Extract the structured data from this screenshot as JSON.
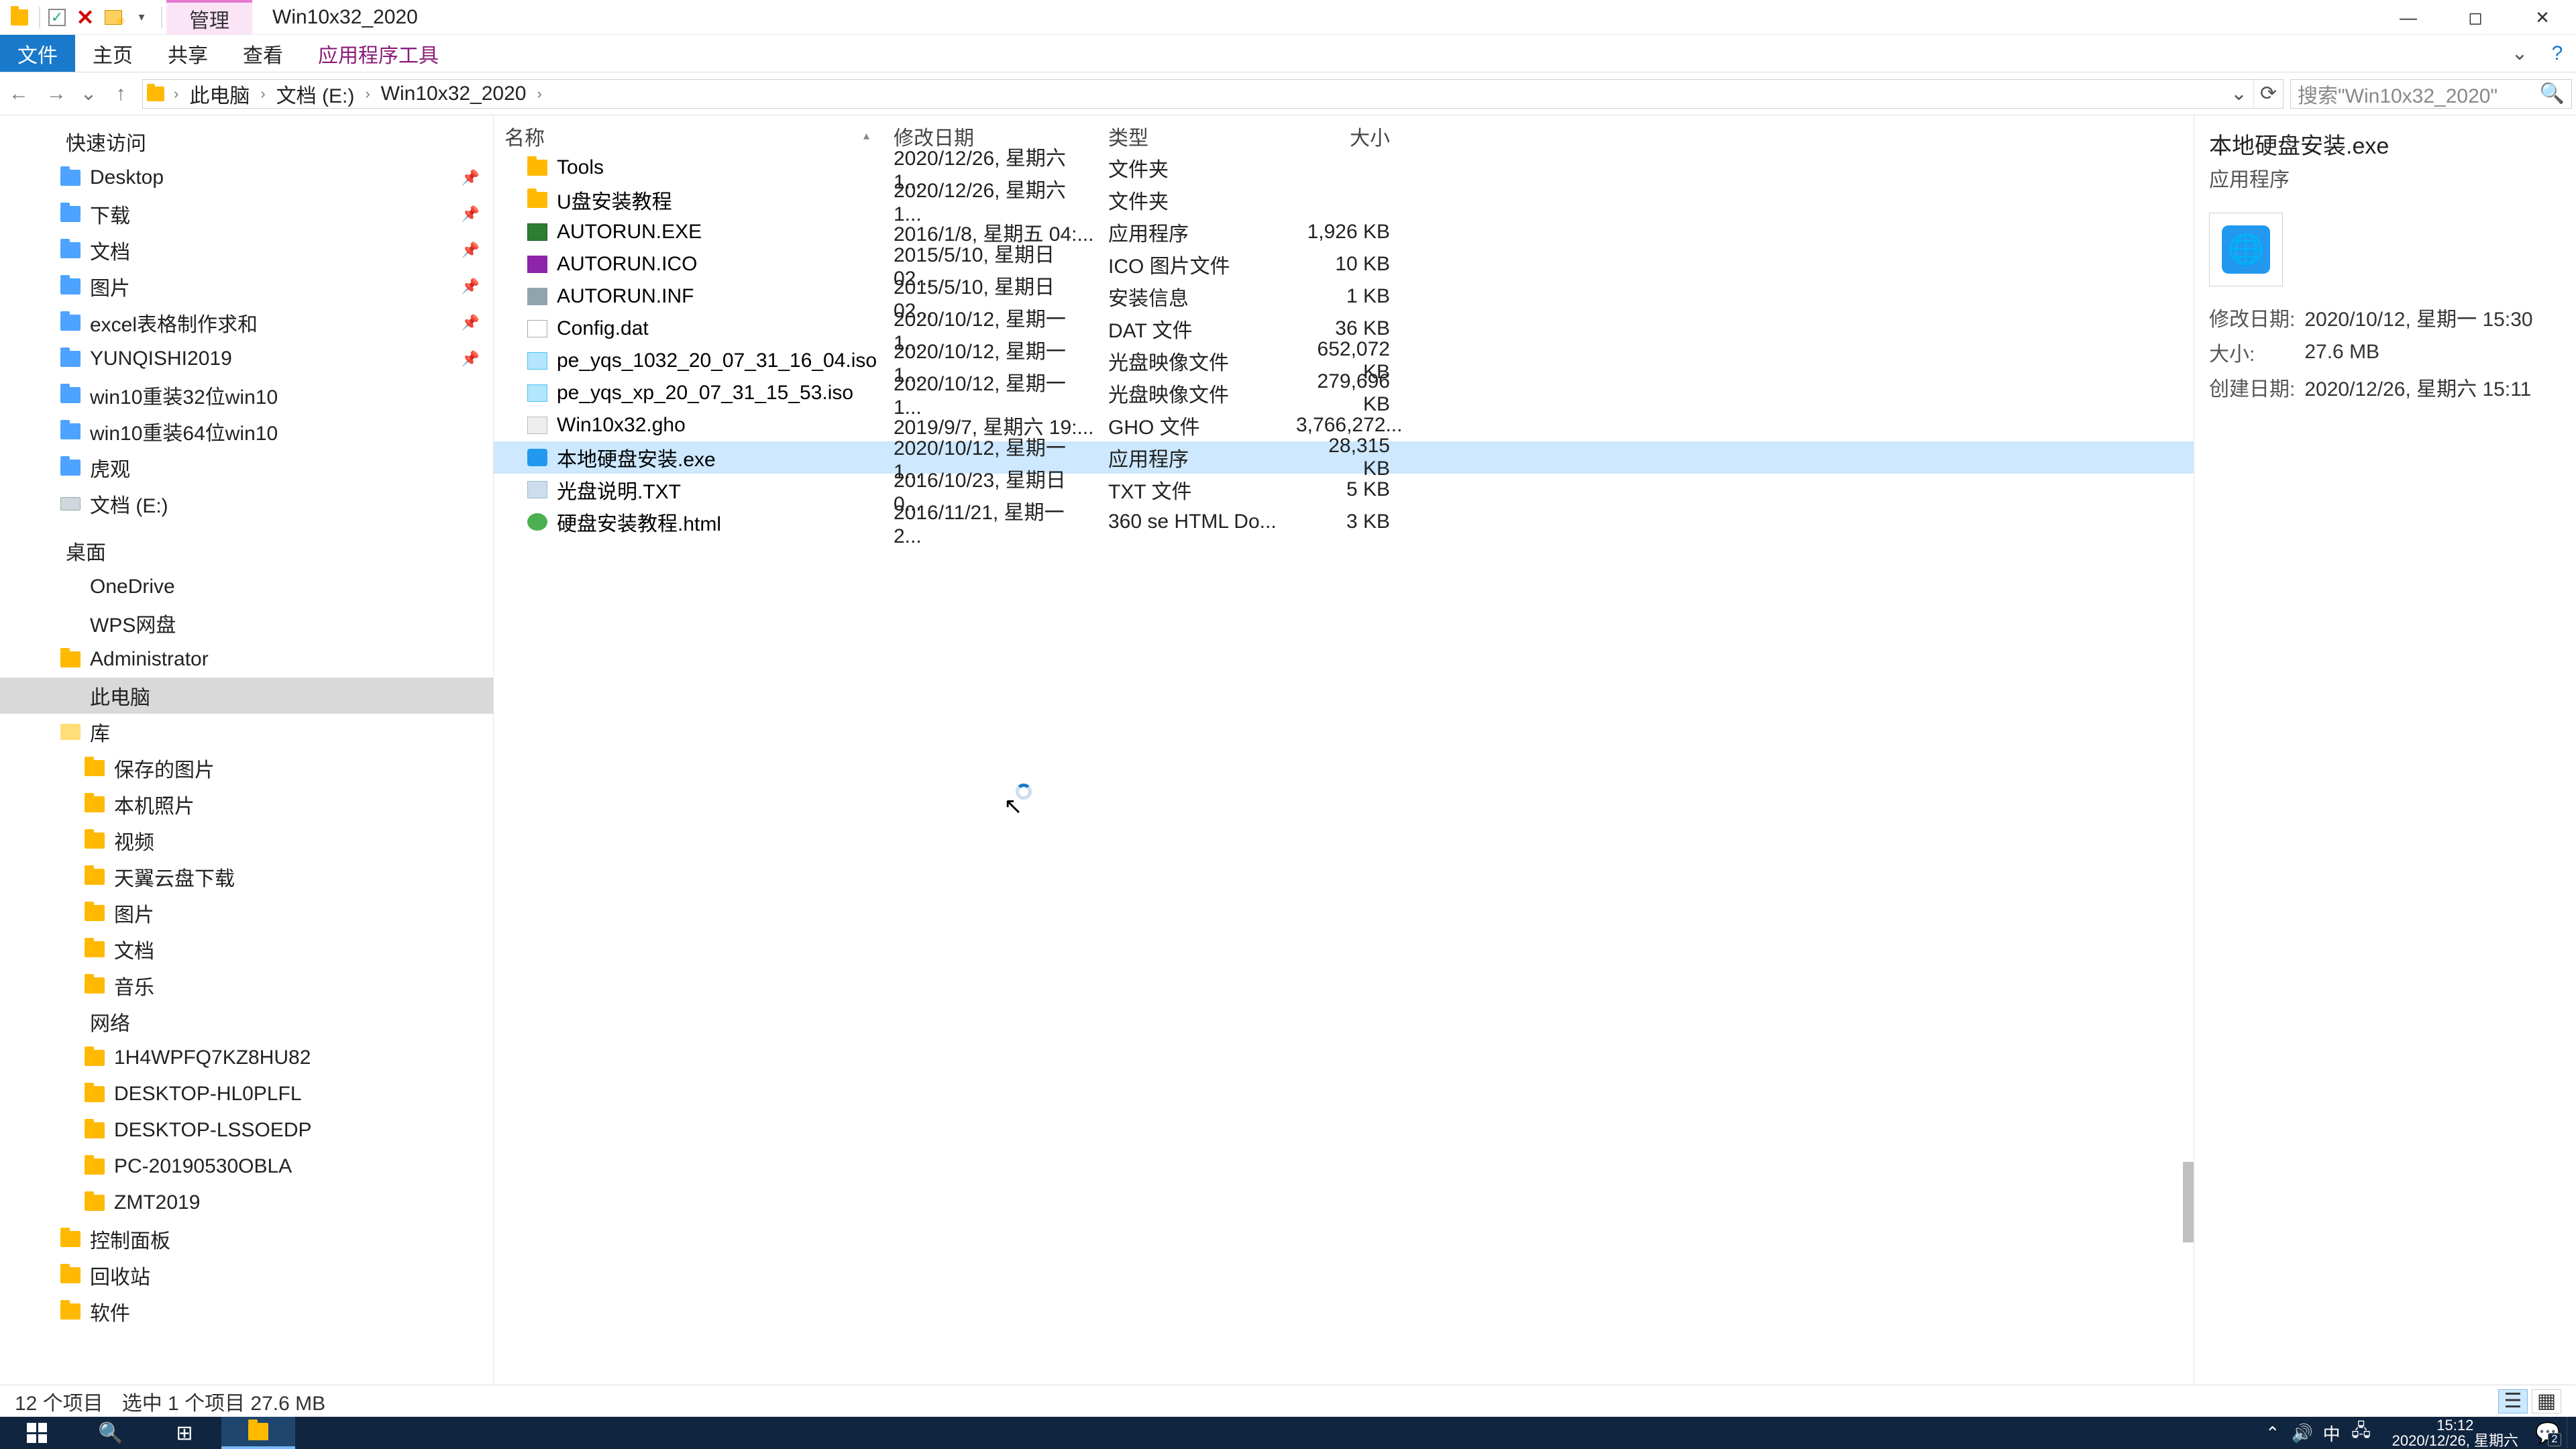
{
  "title": {
    "manage": "管理",
    "folder": "Win10x32_2020"
  },
  "ribbon": {
    "file": "文件",
    "home": "主页",
    "share": "共享",
    "view": "查看",
    "apptools": "应用程序工具"
  },
  "nav": {
    "segs": [
      "此电脑",
      "文档 (E:)",
      "Win10x32_2020"
    ]
  },
  "search": {
    "placeholder": "搜索\"Win10x32_2020\""
  },
  "tree": {
    "quick": "快速访问",
    "quick_items": [
      {
        "t": "Desktop",
        "pin": true
      },
      {
        "t": "下载",
        "pin": true
      },
      {
        "t": "文档",
        "pin": true
      },
      {
        "t": "图片",
        "pin": true
      },
      {
        "t": "excel表格制作求和",
        "pin": true
      },
      {
        "t": "YUNQISHI2019",
        "pin": true
      },
      {
        "t": "win10重装32位win10",
        "pin": false
      },
      {
        "t": "win10重装64位win10",
        "pin": false
      },
      {
        "t": "虎观",
        "pin": false
      },
      {
        "t": "文档 (E:)",
        "pin": false
      }
    ],
    "desktop": "桌面",
    "desktop_items": [
      {
        "t": "OneDrive"
      },
      {
        "t": "WPS网盘"
      },
      {
        "t": "Administrator"
      },
      {
        "t": "此电脑",
        "sel": true
      },
      {
        "t": "库"
      },
      {
        "t": "保存的图片",
        "lvl": 3
      },
      {
        "t": "本机照片",
        "lvl": 3
      },
      {
        "t": "视频",
        "lvl": 3
      },
      {
        "t": "天翼云盘下载",
        "lvl": 3
      },
      {
        "t": "图片",
        "lvl": 3
      },
      {
        "t": "文档",
        "lvl": 3
      },
      {
        "t": "音乐",
        "lvl": 3
      },
      {
        "t": "网络"
      },
      {
        "t": "1H4WPFQ7KZ8HU82",
        "lvl": 3
      },
      {
        "t": "DESKTOP-HL0PLFL",
        "lvl": 3
      },
      {
        "t": "DESKTOP-LSSOEDP",
        "lvl": 3
      },
      {
        "t": "PC-20190530OBLA",
        "lvl": 3
      },
      {
        "t": "ZMT2019",
        "lvl": 3
      },
      {
        "t": "控制面板"
      },
      {
        "t": "回收站"
      },
      {
        "t": "软件"
      }
    ]
  },
  "cols": {
    "name": "名称",
    "mod": "修改日期",
    "typ": "类型",
    "siz": "大小"
  },
  "rows": [
    {
      "ico": "fold",
      "n": "Tools",
      "m": "2020/12/26, 星期六 1...",
      "t": "文件夹",
      "s": ""
    },
    {
      "ico": "fold",
      "n": "U盘安装教程",
      "m": "2020/12/26, 星期六 1...",
      "t": "文件夹",
      "s": ""
    },
    {
      "ico": "exe",
      "n": "AUTORUN.EXE",
      "m": "2016/1/8, 星期五 04:...",
      "t": "应用程序",
      "s": "1,926 KB"
    },
    {
      "ico": "ico",
      "n": "AUTORUN.ICO",
      "m": "2015/5/10, 星期日 02...",
      "t": "ICO 图片文件",
      "s": "10 KB"
    },
    {
      "ico": "inf",
      "n": "AUTORUN.INF",
      "m": "2015/5/10, 星期日 02...",
      "t": "安装信息",
      "s": "1 KB"
    },
    {
      "ico": "dat",
      "n": "Config.dat",
      "m": "2020/10/12, 星期一 1...",
      "t": "DAT 文件",
      "s": "36 KB"
    },
    {
      "ico": "iso",
      "n": "pe_yqs_1032_20_07_31_16_04.iso",
      "m": "2020/10/12, 星期一 1...",
      "t": "光盘映像文件",
      "s": "652,072 KB"
    },
    {
      "ico": "iso",
      "n": "pe_yqs_xp_20_07_31_15_53.iso",
      "m": "2020/10/12, 星期一 1...",
      "t": "光盘映像文件",
      "s": "279,696 KB"
    },
    {
      "ico": "gho",
      "n": "Win10x32.gho",
      "m": "2019/9/7, 星期六 19:...",
      "t": "GHO 文件",
      "s": "3,766,272..."
    },
    {
      "ico": "app",
      "n": "本地硬盘安装.exe",
      "m": "2020/10/12, 星期一 1...",
      "t": "应用程序",
      "s": "28,315 KB",
      "sel": true
    },
    {
      "ico": "txt",
      "n": "光盘说明.TXT",
      "m": "2016/10/23, 星期日 0...",
      "t": "TXT 文件",
      "s": "5 KB"
    },
    {
      "ico": "html",
      "n": "硬盘安装教程.html",
      "m": "2016/11/21, 星期一 2...",
      "t": "360 se HTML Do...",
      "s": "3 KB"
    }
  ],
  "preview": {
    "title": "本地硬盘安装.exe",
    "type": "应用程序",
    "rows": [
      {
        "k": "修改日期:",
        "v": "2020/10/12, 星期一 15:30"
      },
      {
        "k": "大小:",
        "v": "27.6 MB"
      },
      {
        "k": "创建日期:",
        "v": "2020/12/26, 星期六 15:11"
      }
    ]
  },
  "status": {
    "items": "12 个项目",
    "sel": "选中 1 个项目  27.6 MB"
  },
  "taskbar": {
    "ime": "中",
    "time": "15:12",
    "date": "2020/12/26, 星期六",
    "notif": "2"
  }
}
